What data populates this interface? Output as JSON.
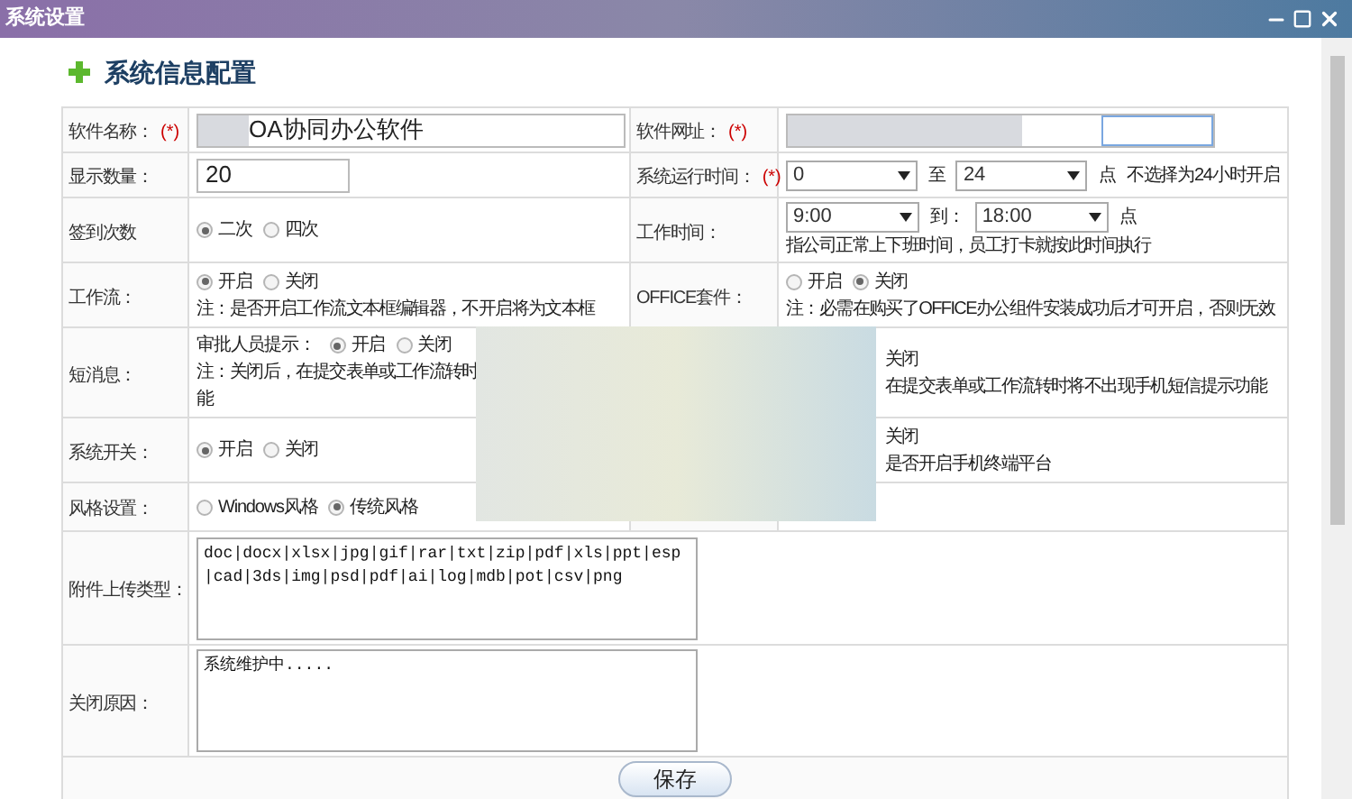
{
  "window": {
    "title": "系统设置"
  },
  "heading": "系统信息配置",
  "rows": [
    [
      {
        "kind": "text",
        "label": "软件名称：",
        "required_mark": "(*)",
        "value": "OA协同办公软件",
        "redacted": true
      },
      {
        "kind": "text",
        "label": "软件网址：",
        "required_mark": "(*)",
        "redacted": true
      }
    ],
    [
      {
        "kind": "text",
        "label": "显示数量：",
        "value": "20"
      },
      {
        "kind": "range",
        "label": "系统运行时间：",
        "required_mark": "(*)",
        "selects": [
          "0",
          "24"
        ],
        "separator": "至",
        "suffix": "点",
        "hint": "不选择为24小时开启"
      }
    ],
    [
      {
        "kind": "radio",
        "label": "签到次数",
        "options": [
          {
            "label": "二次",
            "selected": true
          },
          {
            "label": "四次",
            "selected": false
          }
        ]
      },
      {
        "kind": "range",
        "label": "工作时间：",
        "selects": [
          "9:00",
          "18:00"
        ],
        "separator": "到：",
        "suffix": "点",
        "notes": [
          "指公司正常上下班时间，员工打卡就按此时间执行"
        ]
      }
    ],
    [
      {
        "kind": "radio",
        "label": "工作流：",
        "options": [
          {
            "label": "开启",
            "selected": true
          },
          {
            "label": "关闭",
            "selected": false
          }
        ],
        "notes": [
          "注：是否开启工作流文本框编辑器，不开启将为文本框"
        ]
      },
      {
        "kind": "radio",
        "label": "OFFICE套件：",
        "options": [
          {
            "label": "开启",
            "selected": false
          },
          {
            "label": "关闭",
            "selected": true
          }
        ],
        "notes": [
          "注：必需在购买了OFFICE办公组件安装成功后才可开启，否则无效"
        ]
      }
    ],
    [
      {
        "kind": "radio",
        "label": "短消息：",
        "prefix": "审批人员提示：",
        "options": [
          {
            "label": "开启",
            "selected": true
          },
          {
            "label": "关闭",
            "selected": false
          }
        ],
        "notes": [
          "注：关闭后，在提交表单或工作流转时",
          "能"
        ]
      },
      {
        "kind": "fragment",
        "lines": [
          "关闭",
          "在提交表单或工作流转时将不出现手机短信提示功能"
        ]
      }
    ],
    [
      {
        "kind": "radio",
        "label": "系统开关：",
        "options": [
          {
            "label": "开启",
            "selected": true
          },
          {
            "label": "关闭",
            "selected": false
          }
        ]
      },
      {
        "kind": "fragment",
        "lines": [
          "关闭",
          "是否开启手机终端平台"
        ]
      }
    ],
    [
      {
        "kind": "radio",
        "label": "风格设置：",
        "options": [
          {
            "label": "Windows风格",
            "selected": false
          },
          {
            "label": "传统风格",
            "selected": true
          }
        ]
      },
      {
        "kind": "empty"
      }
    ],
    [
      {
        "kind": "textarea",
        "label": "附件上传类型：",
        "value": "doc|docx|xlsx|jpg|gif|rar|txt|zip|pdf|xls|ppt|esp|cad|3ds|img|psd|pdf|ai|log|mdb|pot|csv|png"
      }
    ],
    [
      {
        "kind": "textarea",
        "label": "关闭原因：",
        "value": "系统维护中....."
      }
    ]
  ],
  "save_button": "保存"
}
